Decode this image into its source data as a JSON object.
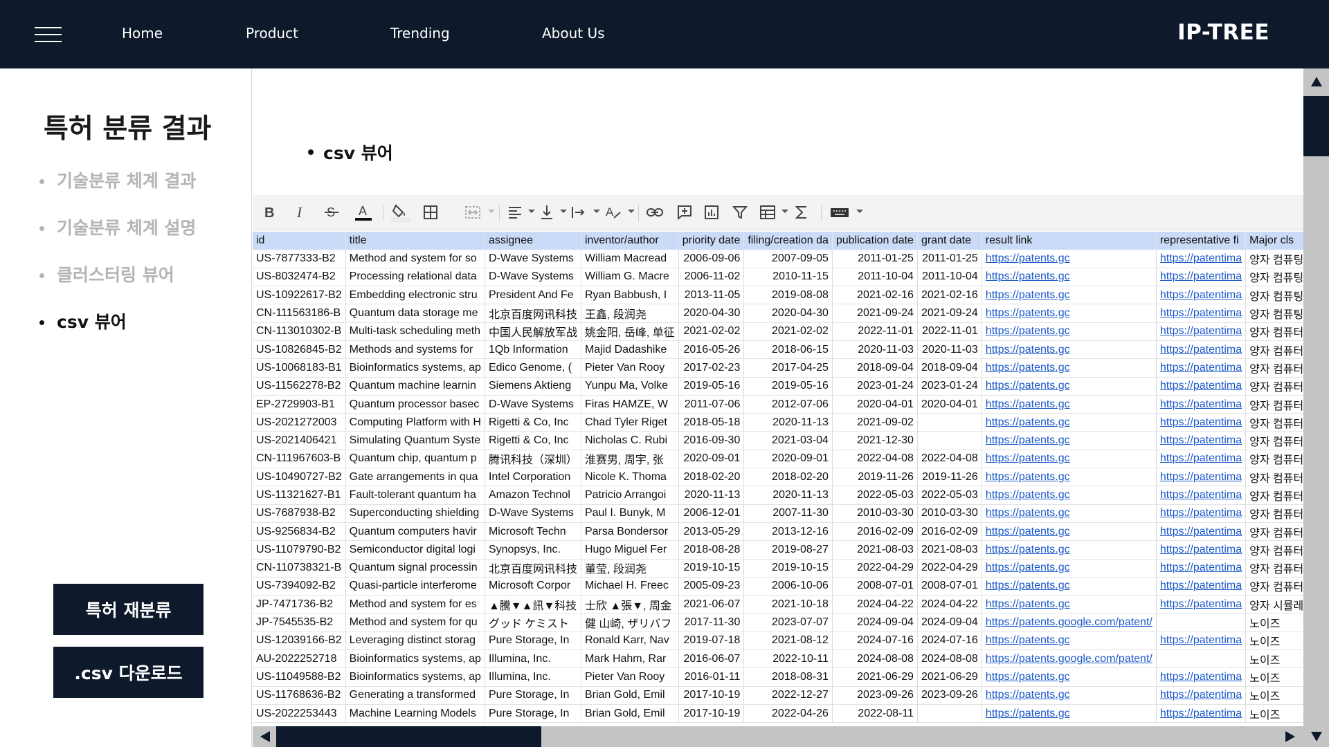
{
  "nav": {
    "links": [
      "Home",
      "Product",
      "Trending",
      "About Us"
    ],
    "brand": "IP-TREE",
    "menu_icon": "hamburger-icon"
  },
  "sidebar": {
    "title": "특허 분류 결과",
    "items": [
      {
        "label": "기술분류 체계 결과",
        "active": false
      },
      {
        "label": "기술분류 체계 설명",
        "active": false
      },
      {
        "label": "클러스터링 뷰어",
        "active": false
      },
      {
        "label": "csv 뷰어",
        "active": true
      }
    ],
    "reclassify_button": "특허 재분류",
    "download_button": ".csv 다운로드"
  },
  "main": {
    "heading": "csv 뷰어"
  },
  "toolbar": {
    "icons": [
      "bold-icon",
      "italic-icon",
      "strikethrough-icon",
      "text-color-icon",
      "fill-color-icon",
      "borders-icon",
      "merge-cells-icon",
      "horizontal-align-icon",
      "vertical-align-icon",
      "text-wrap-icon",
      "text-rotate-icon",
      "link-icon",
      "comment-icon",
      "chart-icon",
      "filter-icon",
      "table-icon",
      "functions-icon",
      "keyboard-icon"
    ]
  },
  "table": {
    "columns": [
      "id",
      "title",
      "assignee",
      "inventor/author",
      "priority date",
      "filing/creation da",
      "publication date",
      "grant date",
      "result link",
      "representative fi",
      "Major cls"
    ],
    "rows": [
      [
        "US-7877333-B2",
        "Method and system for so",
        "D-Wave Systems",
        "William Macread",
        "2006-09-06",
        "2007-09-05",
        "2011-01-25",
        "2011-01-25",
        "https://patents.gc",
        "https://patentima",
        "양자 컴퓨팅 시스템"
      ],
      [
        "US-8032474-B2",
        "Processing relational data",
        "D-Wave Systems",
        "William G. Macre",
        "2006-11-02",
        "2010-11-15",
        "2011-10-04",
        "2011-10-04",
        "https://patents.gc",
        "https://patentima",
        "양자 컴퓨팅 시스템"
      ],
      [
        "US-10922617-B2",
        "Embedding electronic stru",
        "President And Fe",
        "Ryan Babbush, I",
        "2013-11-05",
        "2019-08-08",
        "2021-02-16",
        "2021-02-16",
        "https://patents.gc",
        "https://patentima",
        "양자 컴퓨팅 시스템"
      ],
      [
        "CN-111563186-B",
        "Quantum data storage me",
        "北京百度网讯科技",
        "王鑫, 段润尧",
        "2020-04-30",
        "2020-04-30",
        "2021-09-24",
        "2021-09-24",
        "https://patents.gc",
        "https://patentima",
        "양자 컴퓨팅 시스템"
      ],
      [
        "CN-113010302-B",
        "Multi-task scheduling meth",
        "中国人民解放军战",
        "姚金阳, 岳峰, 单征",
        "2021-02-02",
        "2021-02-02",
        "2022-11-01",
        "2022-11-01",
        "https://patents.gc",
        "https://patentima",
        "양자 컴퓨터 응용 시스템"
      ],
      [
        "US-10826845-B2",
        "Methods and systems for",
        "1Qb Information",
        "Majid Dadashike",
        "2016-05-26",
        "2018-06-15",
        "2020-11-03",
        "2020-11-03",
        "https://patents.gc",
        "https://patentima",
        "양자 컴퓨터 응용 시스템"
      ],
      [
        "US-10068183-B1",
        "Bioinformatics systems, ap",
        "Edico Genome, (",
        "Pieter Van Rooy",
        "2017-02-23",
        "2017-04-25",
        "2018-09-04",
        "2018-09-04",
        "https://patents.gc",
        "https://patentima",
        "양자 컴퓨터 응용 시스템"
      ],
      [
        "US-11562278-B2",
        "Quantum machine learnin",
        "Siemens Aktieng",
        "Yunpu Ma, Volke",
        "2019-05-16",
        "2019-05-16",
        "2023-01-24",
        "2023-01-24",
        "https://patents.gc",
        "https://patentima",
        "양자 컴퓨터 응용 시스템"
      ],
      [
        "EP-2729903-B1",
        "Quantum processor basec",
        "D-Wave Systems",
        "Firas HAMZE, W",
        "2011-07-06",
        "2012-07-06",
        "2020-04-01",
        "2020-04-01",
        "https://patents.gc",
        "https://patentima",
        "양자 컴퓨터 하드웨어"
      ],
      [
        "US-2021272003",
        "Computing Platform with H",
        "Rigetti & Co, Inc",
        "Chad Tyler Riget",
        "2018-05-18",
        "2020-11-13",
        "2021-09-02",
        "",
        "https://patents.gc",
        "https://patentima",
        "양자 컴퓨터 하드웨어"
      ],
      [
        "US-2021406421",
        "Simulating Quantum Syste",
        "Rigetti & Co, Inc",
        "Nicholas C. Rubi",
        "2016-09-30",
        "2021-03-04",
        "2021-12-30",
        "",
        "https://patents.gc",
        "https://patentima",
        "양자 컴퓨터 하드웨어"
      ],
      [
        "CN-111967603-B",
        "Quantum chip, quantum p",
        "腾讯科技（深圳）",
        "淮赛男, 周宇, 张",
        "2020-09-01",
        "2020-09-01",
        "2022-04-08",
        "2022-04-08",
        "https://patents.gc",
        "https://patentima",
        "양자 컴퓨터 하드웨어"
      ],
      [
        "US-10490727-B2",
        "Gate arrangements in qua",
        "Intel Corporation",
        "Nicole K. Thoma",
        "2018-02-20",
        "2018-02-20",
        "2019-11-26",
        "2019-11-26",
        "https://patents.gc",
        "https://patentima",
        "양자 컴퓨터 하드웨어"
      ],
      [
        "US-11321627-B1",
        "Fault-tolerant quantum ha",
        "Amazon Technol",
        "Patricio Arrangoi",
        "2020-11-13",
        "2020-11-13",
        "2022-05-03",
        "2022-05-03",
        "https://patents.gc",
        "https://patentima",
        "양자 컴퓨터 하드웨어"
      ],
      [
        "US-7687938-B2",
        "Superconducting shielding",
        "D-Wave Systems",
        "Paul I. Bunyk, M",
        "2006-12-01",
        "2007-11-30",
        "2010-03-30",
        "2010-03-30",
        "https://patents.gc",
        "https://patentima",
        "양자 컴퓨터 하드웨어"
      ],
      [
        "US-9256834-B2",
        "Quantum computers havir",
        "Microsoft Techn",
        "Parsa Bondersor",
        "2013-05-29",
        "2013-12-16",
        "2016-02-09",
        "2016-02-09",
        "https://patents.gc",
        "https://patentima",
        "양자 컴퓨터 하드웨어"
      ],
      [
        "US-11079790-B2",
        "Semiconductor digital logi",
        "Synopsys, Inc.",
        "Hugo Miguel Fer",
        "2018-08-28",
        "2019-08-27",
        "2021-08-03",
        "2021-08-03",
        "https://patents.gc",
        "https://patentima",
        "양자 컴퓨터 하드웨어"
      ],
      [
        "CN-110738321-B",
        "Quantum signal processin",
        "北京百度网讯科技",
        "董莹, 段润尧",
        "2019-10-15",
        "2019-10-15",
        "2022-04-29",
        "2022-04-29",
        "https://patents.gc",
        "https://patentima",
        "양자 컴퓨터 하드웨어"
      ],
      [
        "US-7394092-B2",
        "Quasi-particle interferome",
        "Microsoft Corpor",
        "Michael H. Freec",
        "2005-09-23",
        "2006-10-06",
        "2008-07-01",
        "2008-07-01",
        "https://patents.gc",
        "https://patentima",
        "양자 컴퓨터 하드웨어"
      ],
      [
        "JP-7471736-B2",
        "Method and system for es",
        "▲騰▼▲訊▼科技",
        "士欣 ▲張▼, 周金",
        "2021-06-07",
        "2021-10-18",
        "2024-04-22",
        "2024-04-22",
        "https://patents.gc",
        "https://patentima",
        "양자 시뮬레이션"
      ],
      [
        "JP-7545535-B2",
        "Method and system for qu",
        "グッド ケミスト",
        "健 山崎, ザリバフ",
        "2017-11-30",
        "2023-07-07",
        "2024-09-04",
        "2024-09-04",
        "https://patents.google.com/patent/",
        "",
        "노이즈"
      ],
      [
        "US-12039166-B2",
        "Leveraging distinct storag",
        "Pure Storage, In",
        "Ronald Karr, Nav",
        "2019-07-18",
        "2021-08-12",
        "2024-07-16",
        "2024-07-16",
        "https://patents.gc",
        "https://patentima",
        "노이즈"
      ],
      [
        "AU-2022252718",
        "Bioinformatics systems, ap",
        "Illumina, Inc.",
        "Mark Hahm, Rar",
        "2016-06-07",
        "2022-10-11",
        "2024-08-08",
        "2024-08-08",
        "https://patents.google.com/patent/",
        "",
        "노이즈"
      ],
      [
        "US-11049588-B2",
        "Bioinformatics systems, ap",
        "Illumina, Inc.",
        "Pieter Van Rooy",
        "2016-01-11",
        "2018-08-31",
        "2021-06-29",
        "2021-06-29",
        "https://patents.gc",
        "https://patentima",
        "노이즈"
      ],
      [
        "US-11768636-B2",
        "Generating a transformed",
        "Pure Storage, In",
        "Brian Gold, Emil",
        "2017-10-19",
        "2022-12-27",
        "2023-09-26",
        "2023-09-26",
        "https://patents.gc",
        "https://patentima",
        "노이즈"
      ],
      [
        "US-2022253443",
        "Machine Learning Models",
        "Pure Storage, In",
        "Brian Gold, Emil",
        "2017-10-19",
        "2022-04-26",
        "2022-08-11",
        "",
        "https://patents.gc",
        "https://patentima",
        "노이즈"
      ]
    ]
  },
  "colors": {
    "navy": "#0e1a2b",
    "header_row": "#c9dbf6",
    "link": "#1a58c9",
    "inactive_text": "#b4b4b4",
    "scrollbar": "#c4c4c4"
  }
}
